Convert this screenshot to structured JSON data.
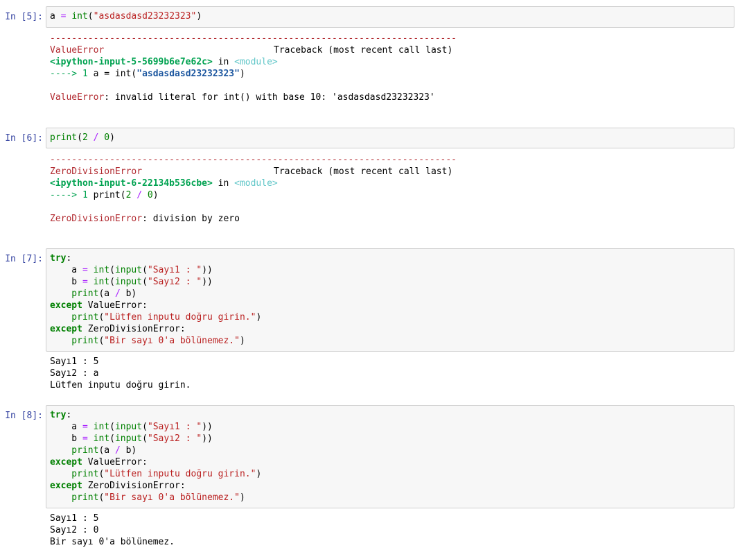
{
  "cells": [
    {
      "prompt": "In [5]:",
      "code": {
        "var": "a",
        "eq": "=",
        "fn": "int",
        "open": "(",
        "str": "\"asdasdasd23232323\"",
        "close": ")"
      },
      "traceback": {
        "dashes": "---------------------------------------------------------------------------",
        "error_name": "ValueError",
        "traceback_header": "Traceback (most recent call last)",
        "file": "<ipython-input-5-5699b6e7e62c>",
        "in_word": " in ",
        "module": "<module>",
        "arrow": "----> 1 ",
        "line_pre": "a = int(",
        "line_str": "\"asdasdasd23232323\"",
        "line_post": ")",
        "final_error": "ValueError",
        "final_msg": ": invalid literal for int() with base 10: 'asdasdasd23232323'"
      }
    },
    {
      "prompt": "In [6]:",
      "code": {
        "fn": "print",
        "open": "(",
        "n1": "2",
        "op": " / ",
        "n2": "0",
        "close": ")"
      },
      "traceback": {
        "dashes": "---------------------------------------------------------------------------",
        "error_name": "ZeroDivisionError",
        "traceback_header": "Traceback (most recent call last)",
        "file": "<ipython-input-6-22134b536cbe>",
        "in_word": " in ",
        "module": "<module>",
        "arrow": "----> 1 ",
        "line_pre": "print(",
        "line_n1": "2",
        "line_op": " / ",
        "line_n2": "0",
        "line_post": ")",
        "final_error": "ZeroDivisionError",
        "final_msg": ": division by zero"
      }
    },
    {
      "prompt": "In [7]:",
      "code_lines": {
        "try": "try",
        "colon": ":",
        "a_var": "    a ",
        "b_var": "    b ",
        "eq": "=",
        "int_fn": " int",
        "input_fn": "input",
        "s1": "\"Sayı1 : \"",
        "s2": "\"Sayı2 : \"",
        "paren_open": "(",
        "paren_close2": "))",
        "print_fn": "    print",
        "print_args_pre": "(a ",
        "slash": "/",
        "print_args_post": " b)",
        "except": "except",
        "value_error": " ValueError:",
        "zero_error": " ZeroDivisionError:",
        "msg1": "\"Lütfen inputu doğru girin.\"",
        "msg2": "\"Bir sayı 0'a bölünemez.\"",
        "close": ")"
      },
      "output": [
        "Sayı1 : 5",
        "Sayı2 : a",
        "Lütfen inputu doğru girin."
      ]
    },
    {
      "prompt": "In [8]:",
      "output": [
        "Sayı1 : 5",
        "Sayı2 : 0",
        "Bir sayı 0'a bölünemez."
      ]
    }
  ]
}
